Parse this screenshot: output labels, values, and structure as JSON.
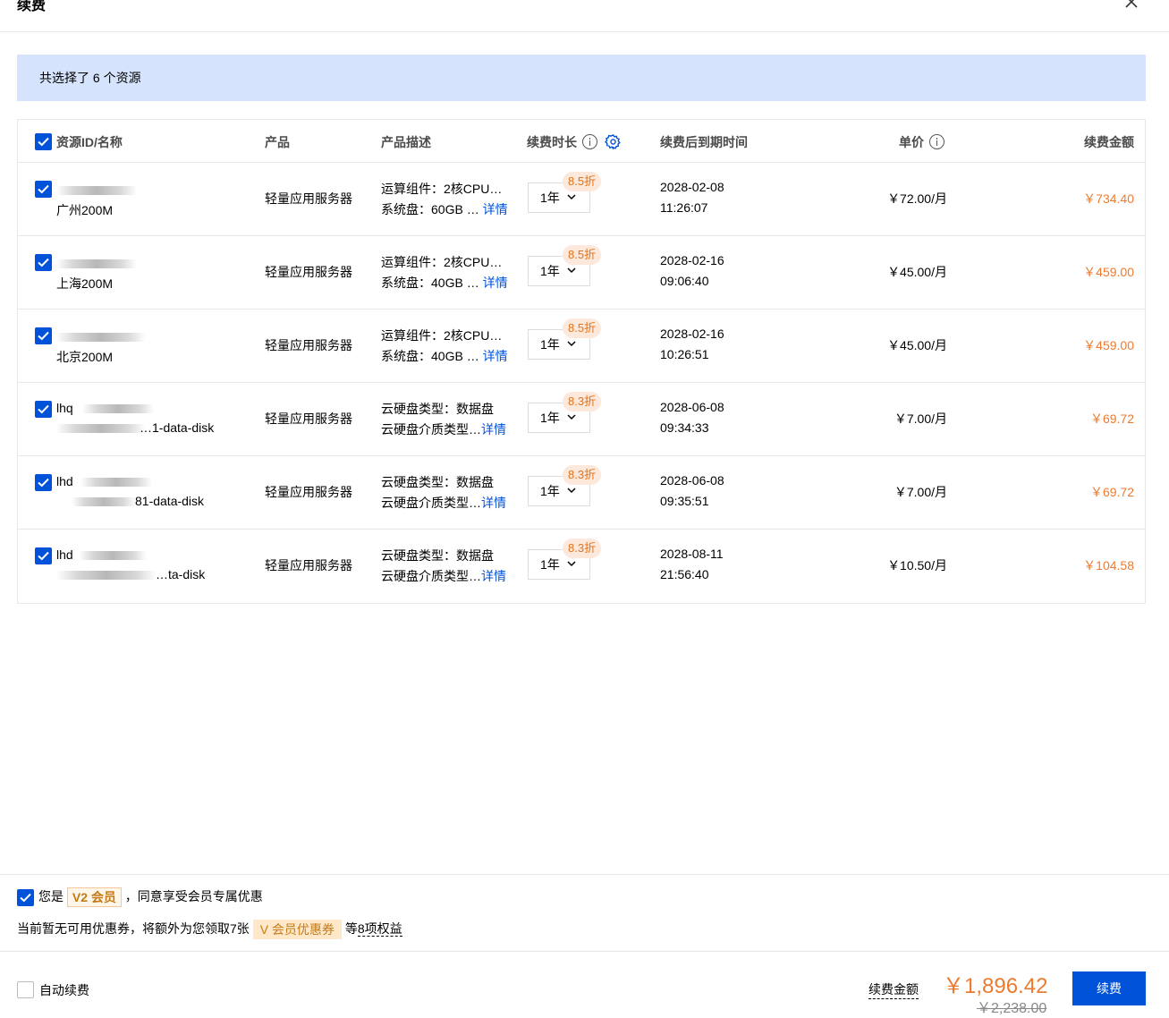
{
  "dialog": {
    "title": "续费"
  },
  "summary": {
    "text": "共选择了 6 个资源"
  },
  "table": {
    "headers": {
      "resource": "资源ID/名称",
      "product": "产品",
      "description": "产品描述",
      "duration": "续费时长",
      "expiry": "续费后到期时间",
      "unit_price": "单价",
      "amount": "续费金额"
    },
    "rows": [
      {
        "name": "广州200M",
        "product": "轻量应用服务器",
        "desc1": "运算组件：2核CPU…",
        "desc2": "系统盘：60GB …",
        "detail": "详情",
        "duration": "1年",
        "discount": "8.5折",
        "date": "2028-02-08",
        "time": "11:26:07",
        "unit_price": "￥72.00/月",
        "amount": "￥734.40"
      },
      {
        "name": "上海200M",
        "product": "轻量应用服务器",
        "desc1": "运算组件：2核CPU…",
        "desc2": "系统盘：40GB …",
        "detail": "详情",
        "duration": "1年",
        "discount": "8.5折",
        "date": "2028-02-16",
        "time": "09:06:40",
        "unit_price": "￥45.00/月",
        "amount": "￥459.00"
      },
      {
        "name": "北京200M",
        "product": "轻量应用服务器",
        "desc1": "运算组件：2核CPU…",
        "desc2": "系统盘：40GB …",
        "detail": "详情",
        "duration": "1年",
        "discount": "8.5折",
        "date": "2028-02-16",
        "time": "10:26:51",
        "unit_price": "￥45.00/月",
        "amount": "￥459.00"
      },
      {
        "id_line": "lhq",
        "name": "…1-data-disk",
        "product": "轻量应用服务器",
        "desc1": "云硬盘类型：数据盘",
        "desc2": "云硬盘介质类型…",
        "detail": "详情",
        "duration": "1年",
        "discount": "8.3折",
        "date": "2028-06-08",
        "time": "09:34:33",
        "unit_price": "￥7.00/月",
        "amount": "￥69.72"
      },
      {
        "id_line": "lhd",
        "name": "81-data-disk",
        "product": "轻量应用服务器",
        "desc1": "云硬盘类型：数据盘",
        "desc2": "云硬盘介质类型…",
        "detail": "详情",
        "duration": "1年",
        "discount": "8.3折",
        "date": "2028-06-08",
        "time": "09:35:51",
        "unit_price": "￥7.00/月",
        "amount": "￥69.72"
      },
      {
        "id_line": "lhd",
        "name": "…ta-disk",
        "product": "轻量应用服务器",
        "desc1": "云硬盘类型：数据盘",
        "desc2": "云硬盘介质类型…",
        "detail": "详情",
        "duration": "1年",
        "discount": "8.3折",
        "date": "2028-08-11",
        "time": "21:56:40",
        "unit_price": "￥10.50/月",
        "amount": "￥104.58"
      }
    ]
  },
  "member": {
    "prefix": "您是",
    "level": "V2 会员",
    "suffix": "，同意享受会员专属优惠",
    "coupon_prefix": "当前暂无可用优惠券，将额外为您领取7张",
    "coupon_tag": "V 会员优惠券",
    "coupon_suffix_1": "等",
    "coupon_suffix_2": "8项权益"
  },
  "footer": {
    "auto_renew": "自动续费",
    "amount_label": "续费金额",
    "total": "￥1,896.42",
    "original_total": "￥2,238.00",
    "renew_button": "续费"
  },
  "colors": {
    "primary": "#0052d9",
    "price": "#ed7b2f",
    "banner": "#d5e3fc"
  }
}
